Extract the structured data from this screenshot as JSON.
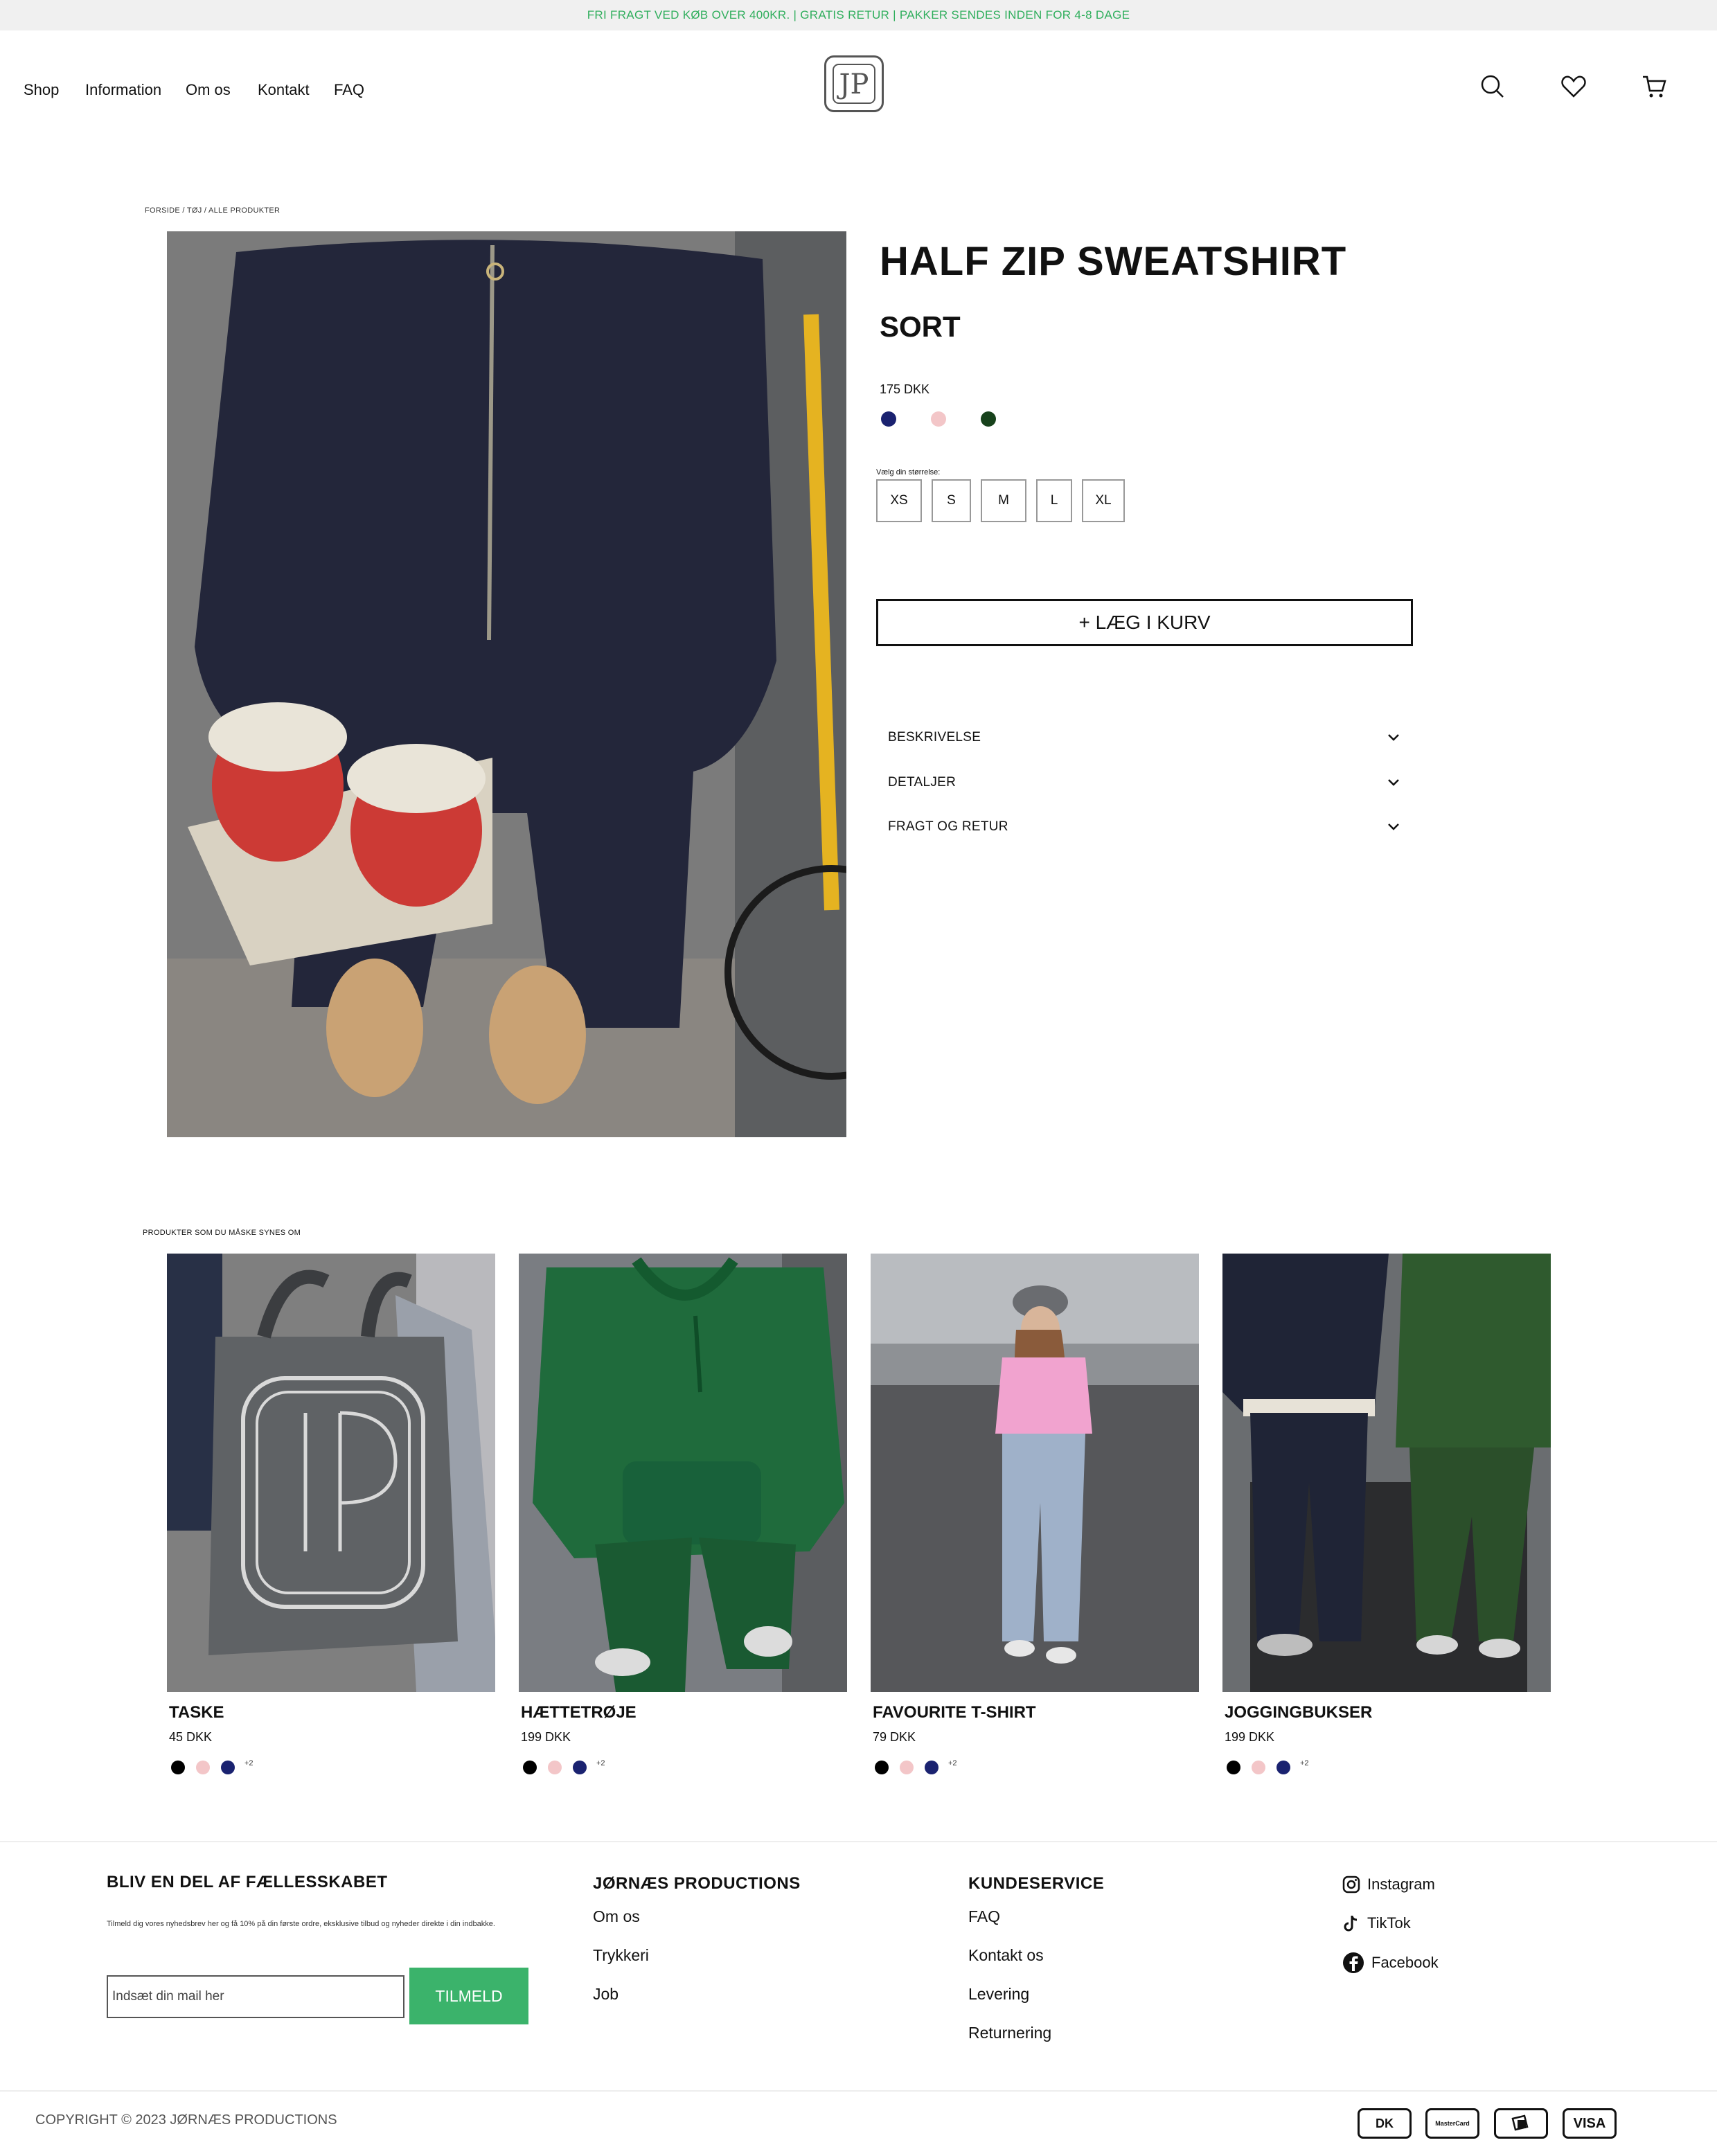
{
  "announcement": "FRI FRAGT VED KØB OVER 400KR. | GRATIS RETUR | PAKKER SENDES INDEN FOR 4-8 DAGE",
  "nav": {
    "items": [
      "Shop",
      "Information",
      "Om os",
      "Kontakt",
      "FAQ"
    ]
  },
  "logo": {
    "letters": "JP"
  },
  "icons": {
    "search": "search-icon",
    "wishlist": "heart-icon",
    "cart": "cart-icon"
  },
  "breadcrumb": "FORSIDE / TØJ / ALLE PRODUKTER",
  "product": {
    "title": "HALF ZIP SWEATSHIRT",
    "variant": "SORT",
    "price": "175 DKK",
    "color_options": [
      "#1a2270",
      "#f3c6c8",
      "#17421c"
    ],
    "size_label": "Vælg din størrelse:",
    "sizes": [
      "XS",
      "S",
      "M",
      "L",
      "XL"
    ],
    "add_to_cart": "+ LÆG I KURV",
    "accordion": [
      "BESKRIVELSE",
      "DETALJER",
      "FRAGT OG RETUR"
    ]
  },
  "recommendations": {
    "heading": "PRODUKTER SOM DU MÅSKE SYNES OM",
    "items": [
      {
        "title": "TASKE",
        "price": "45 DKK",
        "more": "+2"
      },
      {
        "title": "HÆTTETRØJE",
        "price": "199 DKK",
        "more": "+2"
      },
      {
        "title": "FAVOURITE T-SHIRT",
        "price": "79 DKK",
        "more": "+2"
      },
      {
        "title": "JOGGINGBUKSER",
        "price": "199 DKK",
        "more": "+2"
      }
    ],
    "swatch_colors": [
      "#000000",
      "#f3c6c8",
      "#1a2270"
    ]
  },
  "footer": {
    "newsletter": {
      "heading": "BLIV EN DEL AF FÆLLESSKABET",
      "text": "Tilmeld dig vores nyhedsbrev her og få 10% på din første ordre, eksklusive tilbud og nyheder direkte i din indbakke.",
      "placeholder": "Indsæt din mail her",
      "button": "TILMELD"
    },
    "company": {
      "heading": "JØRNÆS PRODUCTIONS",
      "links": [
        "Om os",
        "Trykkeri",
        "Job"
      ]
    },
    "service": {
      "heading": "KUNDESERVICE",
      "links": [
        "FAQ",
        "Kontakt os",
        "Levering",
        "Returnering"
      ]
    },
    "social": [
      "Instagram",
      "TikTok",
      "Facebook"
    ],
    "copyright": "COPYRIGHT © 2023 JØRNÆS PRODUCTIONS",
    "payments": [
      "DK",
      "MasterCard",
      "MobilePay",
      "VISA"
    ]
  },
  "colors": {
    "accent": "#3bb36b",
    "announcement_text": "#2fae5c"
  }
}
